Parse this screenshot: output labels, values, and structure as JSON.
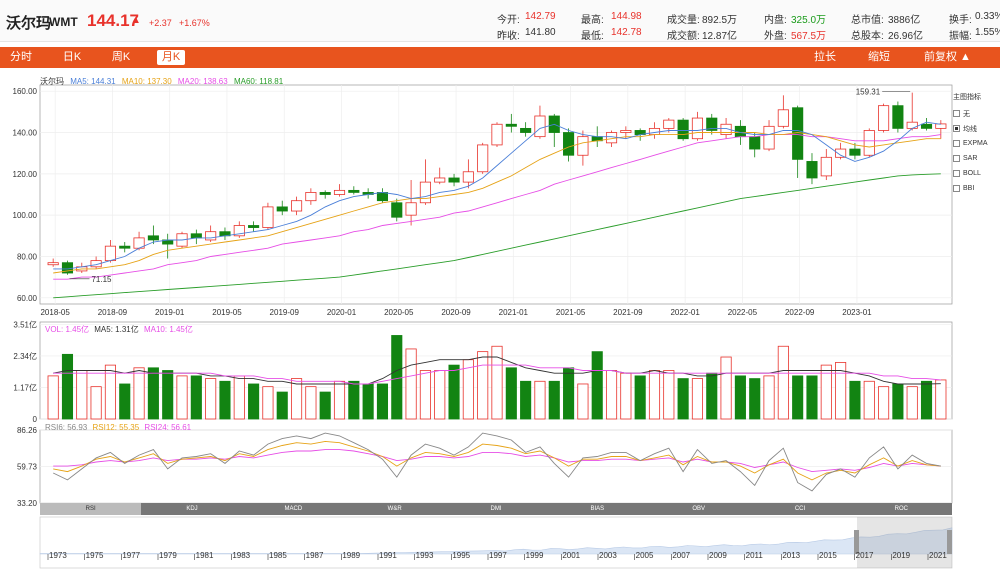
{
  "header": {
    "name": "沃尔玛",
    "code": "WMT",
    "price": "144.17",
    "arrow": "▲",
    "change": "+2.37",
    "change_pct": "+1.67%",
    "stats": [
      {
        "label": "今开:",
        "value": "142.79",
        "color": "red"
      },
      {
        "label": "昨收:",
        "value": "141.80",
        "color": ""
      },
      {
        "label": "最高:",
        "value": "144.98",
        "color": "red"
      },
      {
        "label": "最低:",
        "value": "142.78",
        "color": "red"
      },
      {
        "label": "成交量:",
        "value": "892.5万",
        "color": ""
      },
      {
        "label": "成交额:",
        "value": "12.87亿",
        "color": ""
      },
      {
        "label": "内盘:",
        "value": "325.0万",
        "color": "green"
      },
      {
        "label": "外盘:",
        "value": "567.5万",
        "color": "red"
      },
      {
        "label": "总市值:",
        "value": "3886亿",
        "color": ""
      },
      {
        "label": "总股本:",
        "value": "26.96亿",
        "color": ""
      },
      {
        "label": "换手:",
        "value": "0.33%",
        "color": ""
      },
      {
        "label": "振幅:",
        "value": "1.55%",
        "color": ""
      }
    ]
  },
  "tabs": {
    "left": [
      "分时",
      "日K",
      "周K",
      "月K"
    ],
    "active": "月K",
    "right": [
      "拉长",
      "缩短",
      "前复权 ▲"
    ]
  },
  "legend_main": {
    "title": "沃尔玛",
    "ma5": "MA5: 144.31",
    "ma10": "MA10: 137.30",
    "ma20": "MA20: 138.63",
    "ma60": "MA60: 118.81"
  },
  "legend_vol": {
    "vol": "VOL: 1.45亿",
    "ma5": "MA5: 1.31亿",
    "ma10": "MA10: 1.45亿"
  },
  "legend_rsi": {
    "rsi6": "RSI6: 56.93",
    "rsi12": "RSI12: 55.35",
    "rsi24": "RSI24: 56.61"
  },
  "indicator_panel": {
    "title": "主图指标",
    "options": [
      "无",
      "均线",
      "EXPMA",
      "SAR",
      "BOLL",
      "BBI"
    ],
    "checked": "均线"
  },
  "indicator_tabs": [
    "RSI",
    "KDJ",
    "MACD",
    "W&R",
    "DMI",
    "BIAS",
    "OBV",
    "CCI",
    "ROC"
  ],
  "indicator_tab_active": "RSI",
  "colors": {
    "up": "#e8322b",
    "down": "#128412",
    "ma5": "#4a7fd8",
    "ma10": "#e6a317",
    "ma20": "#e64ee6",
    "ma60": "#2a9d2a",
    "rsi6": "#888888",
    "rsi12": "#e6a317",
    "rsi24": "#e64ee6",
    "accent": "#e8541e"
  },
  "chart_data": {
    "type": "candlestick",
    "x_tick_labels": [
      "2018-05",
      "2018-09",
      "2019-01",
      "2019-05",
      "2019-09",
      "2020-01",
      "2020-05",
      "2020-09",
      "2021-01",
      "2021-05",
      "2021-09",
      "2022-01",
      "2022-05",
      "2022-09",
      "2023-01"
    ],
    "y_ticks": [
      "60.00",
      "80.00",
      "100.00",
      "120.00",
      "140.00",
      "160.00"
    ],
    "ylim": [
      57,
      163
    ],
    "annotations": [
      {
        "text": "159.31",
        "value": 159.31
      },
      {
        "text": "71.15",
        "value": 71.15
      }
    ],
    "candles": [
      {
        "o": 76,
        "c": 77,
        "h": 79,
        "l": 75
      },
      {
        "o": 77,
        "c": 72,
        "h": 78,
        "l": 71.15
      },
      {
        "o": 73,
        "c": 75,
        "h": 77,
        "l": 72
      },
      {
        "o": 75,
        "c": 78,
        "h": 80,
        "l": 74
      },
      {
        "o": 78,
        "c": 85,
        "h": 88,
        "l": 77
      },
      {
        "o": 85,
        "c": 84,
        "h": 87,
        "l": 82
      },
      {
        "o": 84,
        "c": 89,
        "h": 92,
        "l": 83
      },
      {
        "o": 90,
        "c": 88,
        "h": 95,
        "l": 86
      },
      {
        "o": 88,
        "c": 86,
        "h": 91,
        "l": 79
      },
      {
        "o": 85,
        "c": 91,
        "h": 92,
        "l": 84
      },
      {
        "o": 91,
        "c": 89,
        "h": 93,
        "l": 86
      },
      {
        "o": 88,
        "c": 92,
        "h": 95,
        "l": 87
      },
      {
        "o": 92,
        "c": 90,
        "h": 94,
        "l": 88
      },
      {
        "o": 90,
        "c": 95,
        "h": 97,
        "l": 89
      },
      {
        "o": 95,
        "c": 94,
        "h": 97,
        "l": 92
      },
      {
        "o": 94,
        "c": 104,
        "h": 106,
        "l": 93
      },
      {
        "o": 104,
        "c": 102,
        "h": 107,
        "l": 100
      },
      {
        "o": 102,
        "c": 107,
        "h": 109,
        "l": 100
      },
      {
        "o": 107,
        "c": 111,
        "h": 113,
        "l": 105
      },
      {
        "o": 111,
        "c": 110,
        "h": 112,
        "l": 108
      },
      {
        "o": 110,
        "c": 112,
        "h": 115,
        "l": 109
      },
      {
        "o": 112,
        "c": 111,
        "h": 114,
        "l": 110
      },
      {
        "o": 111,
        "c": 110,
        "h": 113,
        "l": 108
      },
      {
        "o": 111,
        "c": 107,
        "h": 113,
        "l": 106
      },
      {
        "o": 106,
        "c": 99,
        "h": 108,
        "l": 97
      },
      {
        "o": 100,
        "c": 106,
        "h": 117,
        "l": 95
      },
      {
        "o": 106,
        "c": 116,
        "h": 127,
        "l": 105
      },
      {
        "o": 116,
        "c": 118,
        "h": 123,
        "l": 115
      },
      {
        "o": 118,
        "c": 116,
        "h": 120,
        "l": 114
      },
      {
        "o": 116,
        "c": 121,
        "h": 127,
        "l": 113
      },
      {
        "o": 121,
        "c": 134,
        "h": 135,
        "l": 120
      },
      {
        "o": 134,
        "c": 144,
        "h": 145,
        "l": 133
      },
      {
        "o": 144,
        "c": 143,
        "h": 149,
        "l": 140
      },
      {
        "o": 142,
        "c": 140,
        "h": 145,
        "l": 138
      },
      {
        "o": 138,
        "c": 148,
        "h": 153,
        "l": 137
      },
      {
        "o": 148,
        "c": 140,
        "h": 149,
        "l": 133
      },
      {
        "o": 140,
        "c": 129,
        "h": 142,
        "l": 126
      },
      {
        "o": 129,
        "c": 138,
        "h": 141,
        "l": 124
      },
      {
        "o": 138,
        "c": 136,
        "h": 143,
        "l": 133
      },
      {
        "o": 135,
        "c": 140,
        "h": 141,
        "l": 133
      },
      {
        "o": 140,
        "c": 141,
        "h": 143,
        "l": 137
      },
      {
        "o": 141,
        "c": 139,
        "h": 142,
        "l": 136
      },
      {
        "o": 139,
        "c": 142,
        "h": 145,
        "l": 137
      },
      {
        "o": 142,
        "c": 146,
        "h": 147,
        "l": 140
      },
      {
        "o": 146,
        "c": 137,
        "h": 147,
        "l": 136
      },
      {
        "o": 137,
        "c": 147,
        "h": 150,
        "l": 136
      },
      {
        "o": 147,
        "c": 141,
        "h": 149,
        "l": 139
      },
      {
        "o": 139,
        "c": 144,
        "h": 147,
        "l": 137
      },
      {
        "o": 143,
        "c": 138,
        "h": 146,
        "l": 134
      },
      {
        "o": 138,
        "c": 132,
        "h": 140,
        "l": 128
      },
      {
        "o": 132,
        "c": 143,
        "h": 146,
        "l": 131
      },
      {
        "o": 143,
        "c": 151,
        "h": 158,
        "l": 142
      },
      {
        "o": 152,
        "c": 127,
        "h": 153,
        "l": 118
      },
      {
        "o": 126,
        "c": 118,
        "h": 130,
        "l": 115
      },
      {
        "o": 119,
        "c": 128,
        "h": 132,
        "l": 117
      },
      {
        "o": 128,
        "c": 132,
        "h": 135,
        "l": 127
      },
      {
        "o": 132,
        "c": 129,
        "h": 135,
        "l": 127
      },
      {
        "o": 129,
        "c": 141,
        "h": 142,
        "l": 128
      },
      {
        "o": 141,
        "c": 153,
        "h": 154,
        "l": 140
      },
      {
        "o": 153,
        "c": 142,
        "h": 155,
        "l": 140
      },
      {
        "o": 142,
        "c": 145,
        "h": 159.31,
        "l": 141
      },
      {
        "o": 144,
        "c": 142,
        "h": 147,
        "l": 141
      },
      {
        "o": 142,
        "c": 144.17,
        "h": 146,
        "l": 137
      }
    ],
    "ma5": [
      74,
      74,
      75,
      76,
      78,
      80,
      84,
      87,
      88,
      88,
      89,
      89,
      90,
      91,
      92,
      93,
      95,
      97,
      100,
      104,
      107,
      109,
      110,
      111,
      110,
      108,
      109,
      111,
      112,
      114,
      118,
      124,
      130,
      136,
      142,
      144,
      141,
      139,
      138,
      138,
      137,
      139,
      140,
      141,
      141,
      141,
      142,
      142,
      140,
      139,
      139,
      141,
      141,
      139,
      134,
      129,
      126,
      128,
      131,
      136,
      142,
      145,
      144
    ],
    "ma10": [
      72,
      73,
      74,
      74,
      75,
      76,
      78,
      81,
      83,
      84,
      85,
      86,
      87,
      88,
      89,
      90,
      92,
      94,
      96,
      98,
      100,
      102,
      104,
      106,
      107,
      108,
      108,
      109,
      110,
      111,
      113,
      116,
      119,
      123,
      127,
      130,
      133,
      135,
      136,
      137,
      138,
      138,
      139,
      139,
      139,
      140,
      140,
      140,
      140,
      140,
      139,
      139,
      140,
      139,
      138,
      136,
      134,
      133,
      134,
      135,
      136,
      137,
      137
    ],
    "ma20": [
      69,
      69,
      70,
      70,
      71,
      72,
      73,
      74,
      76,
      77,
      78,
      80,
      81,
      82,
      83,
      84,
      86,
      87,
      88,
      89,
      90,
      92,
      93,
      95,
      96,
      97,
      98,
      99,
      101,
      102,
      104,
      106,
      108,
      110,
      112,
      115,
      117,
      119,
      121,
      123,
      125,
      127,
      129,
      131,
      133,
      135,
      136,
      137,
      138,
      138,
      139,
      139,
      139,
      138,
      138,
      137,
      136,
      136,
      136,
      137,
      138,
      138,
      139
    ],
    "ma60": [
      60,
      60.5,
      61,
      61.5,
      62,
      62.5,
      63,
      63.5,
      64,
      64.5,
      65,
      65.5,
      66,
      66.5,
      67,
      67.5,
      68,
      68.5,
      69,
      69.5,
      70,
      71,
      72,
      73,
      74,
      75,
      76,
      77,
      78,
      79.5,
      81,
      82.5,
      84,
      85.5,
      87,
      88.5,
      90,
      91.5,
      93,
      94.5,
      96,
      97.5,
      99,
      100.5,
      102,
      103.5,
      105,
      106.5,
      108,
      109,
      110,
      111,
      112,
      113,
      114,
      115,
      116,
      117,
      118,
      119,
      119.5,
      119.8,
      120
    ],
    "volume": {
      "ylim": [
        0,
        3.6
      ],
      "y_ticks": [
        "0",
        "1.17亿",
        "2.34亿",
        "3.51亿"
      ],
      "values": [
        1.6,
        2.4,
        1.8,
        1.2,
        2.0,
        1.3,
        1.9,
        1.9,
        1.8,
        1.6,
        1.6,
        1.5,
        1.4,
        1.6,
        1.3,
        1.2,
        1.0,
        1.5,
        1.2,
        1.0,
        1.4,
        1.4,
        1.3,
        1.3,
        3.1,
        2.6,
        1.8,
        1.8,
        2.0,
        2.2,
        2.5,
        2.7,
        1.9,
        1.4,
        1.4,
        1.4,
        1.9,
        1.3,
        2.5,
        1.8,
        1.7,
        1.6,
        1.8,
        1.8,
        1.5,
        1.5,
        1.7,
        2.3,
        1.6,
        1.5,
        1.6,
        2.7,
        1.6,
        1.6,
        2.0,
        2.1,
        1.4,
        1.4,
        1.2,
        1.3,
        1.2,
        1.4,
        1.45
      ],
      "ma5": [
        1.7,
        1.8,
        1.8,
        1.8,
        1.8,
        1.7,
        1.8,
        1.7,
        1.7,
        1.7,
        1.7,
        1.6,
        1.6,
        1.5,
        1.5,
        1.4,
        1.4,
        1.3,
        1.3,
        1.3,
        1.3,
        1.3,
        1.3,
        1.5,
        1.8,
        2.0,
        2.1,
        2.2,
        2.2,
        2.2,
        2.3,
        2.3,
        2.1,
        1.9,
        1.8,
        1.7,
        1.7,
        1.7,
        1.8,
        1.8,
        1.7,
        1.7,
        1.8,
        1.7,
        1.7,
        1.6,
        1.6,
        1.7,
        1.7,
        1.7,
        1.7,
        1.8,
        1.8,
        1.8,
        1.8,
        1.8,
        1.7,
        1.6,
        1.4,
        1.3,
        1.3,
        1.3,
        1.31
      ],
      "ma10": [
        1.7,
        1.7,
        1.7,
        1.7,
        1.7,
        1.7,
        1.7,
        1.7,
        1.7,
        1.7,
        1.7,
        1.7,
        1.6,
        1.6,
        1.6,
        1.5,
        1.5,
        1.4,
        1.4,
        1.4,
        1.4,
        1.3,
        1.3,
        1.4,
        1.5,
        1.6,
        1.7,
        1.8,
        1.8,
        1.9,
        2.0,
        2.0,
        2.0,
        2.0,
        1.9,
        1.9,
        1.9,
        1.8,
        1.8,
        1.8,
        1.7,
        1.7,
        1.7,
        1.7,
        1.7,
        1.7,
        1.7,
        1.7,
        1.7,
        1.7,
        1.7,
        1.7,
        1.7,
        1.7,
        1.7,
        1.7,
        1.7,
        1.7,
        1.6,
        1.6,
        1.5,
        1.5,
        1.45
      ]
    },
    "rsi": {
      "ylim": [
        33.2,
        86.26
      ],
      "y_ticks": [
        "33.20",
        "59.73",
        "86.26"
      ],
      "rsi6": [
        55,
        50,
        58,
        66,
        70,
        62,
        68,
        72,
        58,
        66,
        67,
        69,
        62,
        71,
        68,
        76,
        80,
        82,
        80,
        84,
        82,
        77,
        72,
        65,
        52,
        68,
        76,
        73,
        68,
        74,
        84,
        82,
        79,
        70,
        74,
        62,
        52,
        66,
        67,
        70,
        70,
        64,
        69,
        73,
        56,
        72,
        62,
        64,
        56,
        46,
        64,
        73,
        48,
        42,
        54,
        58,
        52,
        66,
        74,
        58,
        68,
        62,
        60
      ],
      "rsi12": [
        58,
        56,
        60,
        65,
        67,
        63,
        66,
        69,
        62,
        65,
        66,
        67,
        64,
        69,
        67,
        72,
        75,
        77,
        76,
        78,
        77,
        74,
        71,
        67,
        60,
        66,
        70,
        69,
        67,
        70,
        76,
        75,
        73,
        69,
        71,
        66,
        60,
        65,
        65,
        67,
        67,
        64,
        66,
        68,
        61,
        67,
        63,
        63,
        60,
        55,
        61,
        65,
        55,
        50,
        55,
        57,
        55,
        61,
        66,
        60,
        64,
        61,
        60
      ],
      "rsi24": [
        60,
        60,
        61,
        63,
        64,
        63,
        64,
        66,
        64,
        65,
        65,
        66,
        65,
        67,
        66,
        68,
        70,
        71,
        71,
        72,
        72,
        71,
        69,
        67,
        64,
        65,
        67,
        67,
        66,
        67,
        70,
        70,
        69,
        67,
        68,
        66,
        63,
        64,
        64,
        65,
        65,
        64,
        65,
        66,
        63,
        65,
        63,
        63,
        62,
        59,
        61,
        63,
        59,
        56,
        57,
        58,
        57,
        59,
        62,
        60,
        62,
        61,
        60
      ]
    },
    "overview_x_labels": [
      "1973",
      "1975",
      "1977",
      "1979",
      "1981",
      "1983",
      "1985",
      "1987",
      "1989",
      "1991",
      "1993",
      "1995",
      "1997",
      "1999",
      "2001",
      "2003",
      "2005",
      "2007",
      "2009",
      "2011",
      "2013",
      "2015",
      "2017",
      "2019",
      "2021"
    ]
  }
}
